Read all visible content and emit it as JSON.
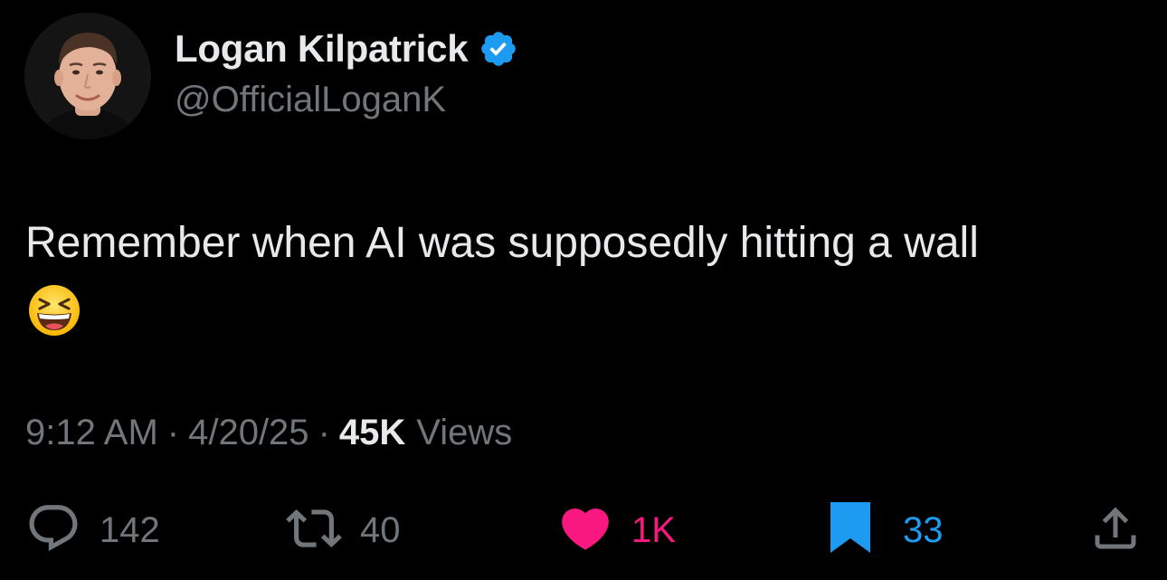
{
  "author": {
    "display_name": "Logan Kilpatrick",
    "handle": "@OfficialLoganK",
    "verified_icon": "verified-badge-icon",
    "avatar": "profile-photo"
  },
  "tweet": {
    "text": "Remember when AI was supposedly hitting a wall",
    "emoji": "😆"
  },
  "meta": {
    "time": "9:12 AM",
    "separator": "·",
    "date": "4/20/25",
    "views_count": "45K",
    "views_label": "Views"
  },
  "actions": {
    "reply": {
      "icon": "reply-icon",
      "count": "142"
    },
    "retweet": {
      "icon": "retweet-icon",
      "count": "40"
    },
    "like": {
      "icon": "heart-icon",
      "count": "1K",
      "active": true
    },
    "bookmark": {
      "icon": "bookmark-icon",
      "count": "33",
      "active": true
    },
    "share": {
      "icon": "share-icon"
    }
  },
  "colors": {
    "background": "#000000",
    "text_primary": "#e7e9ea",
    "text_secondary": "#71767b",
    "verified_blue": "#1d9bf0",
    "like_pink": "#f91880",
    "bookmark_blue": "#1d9bf0"
  }
}
